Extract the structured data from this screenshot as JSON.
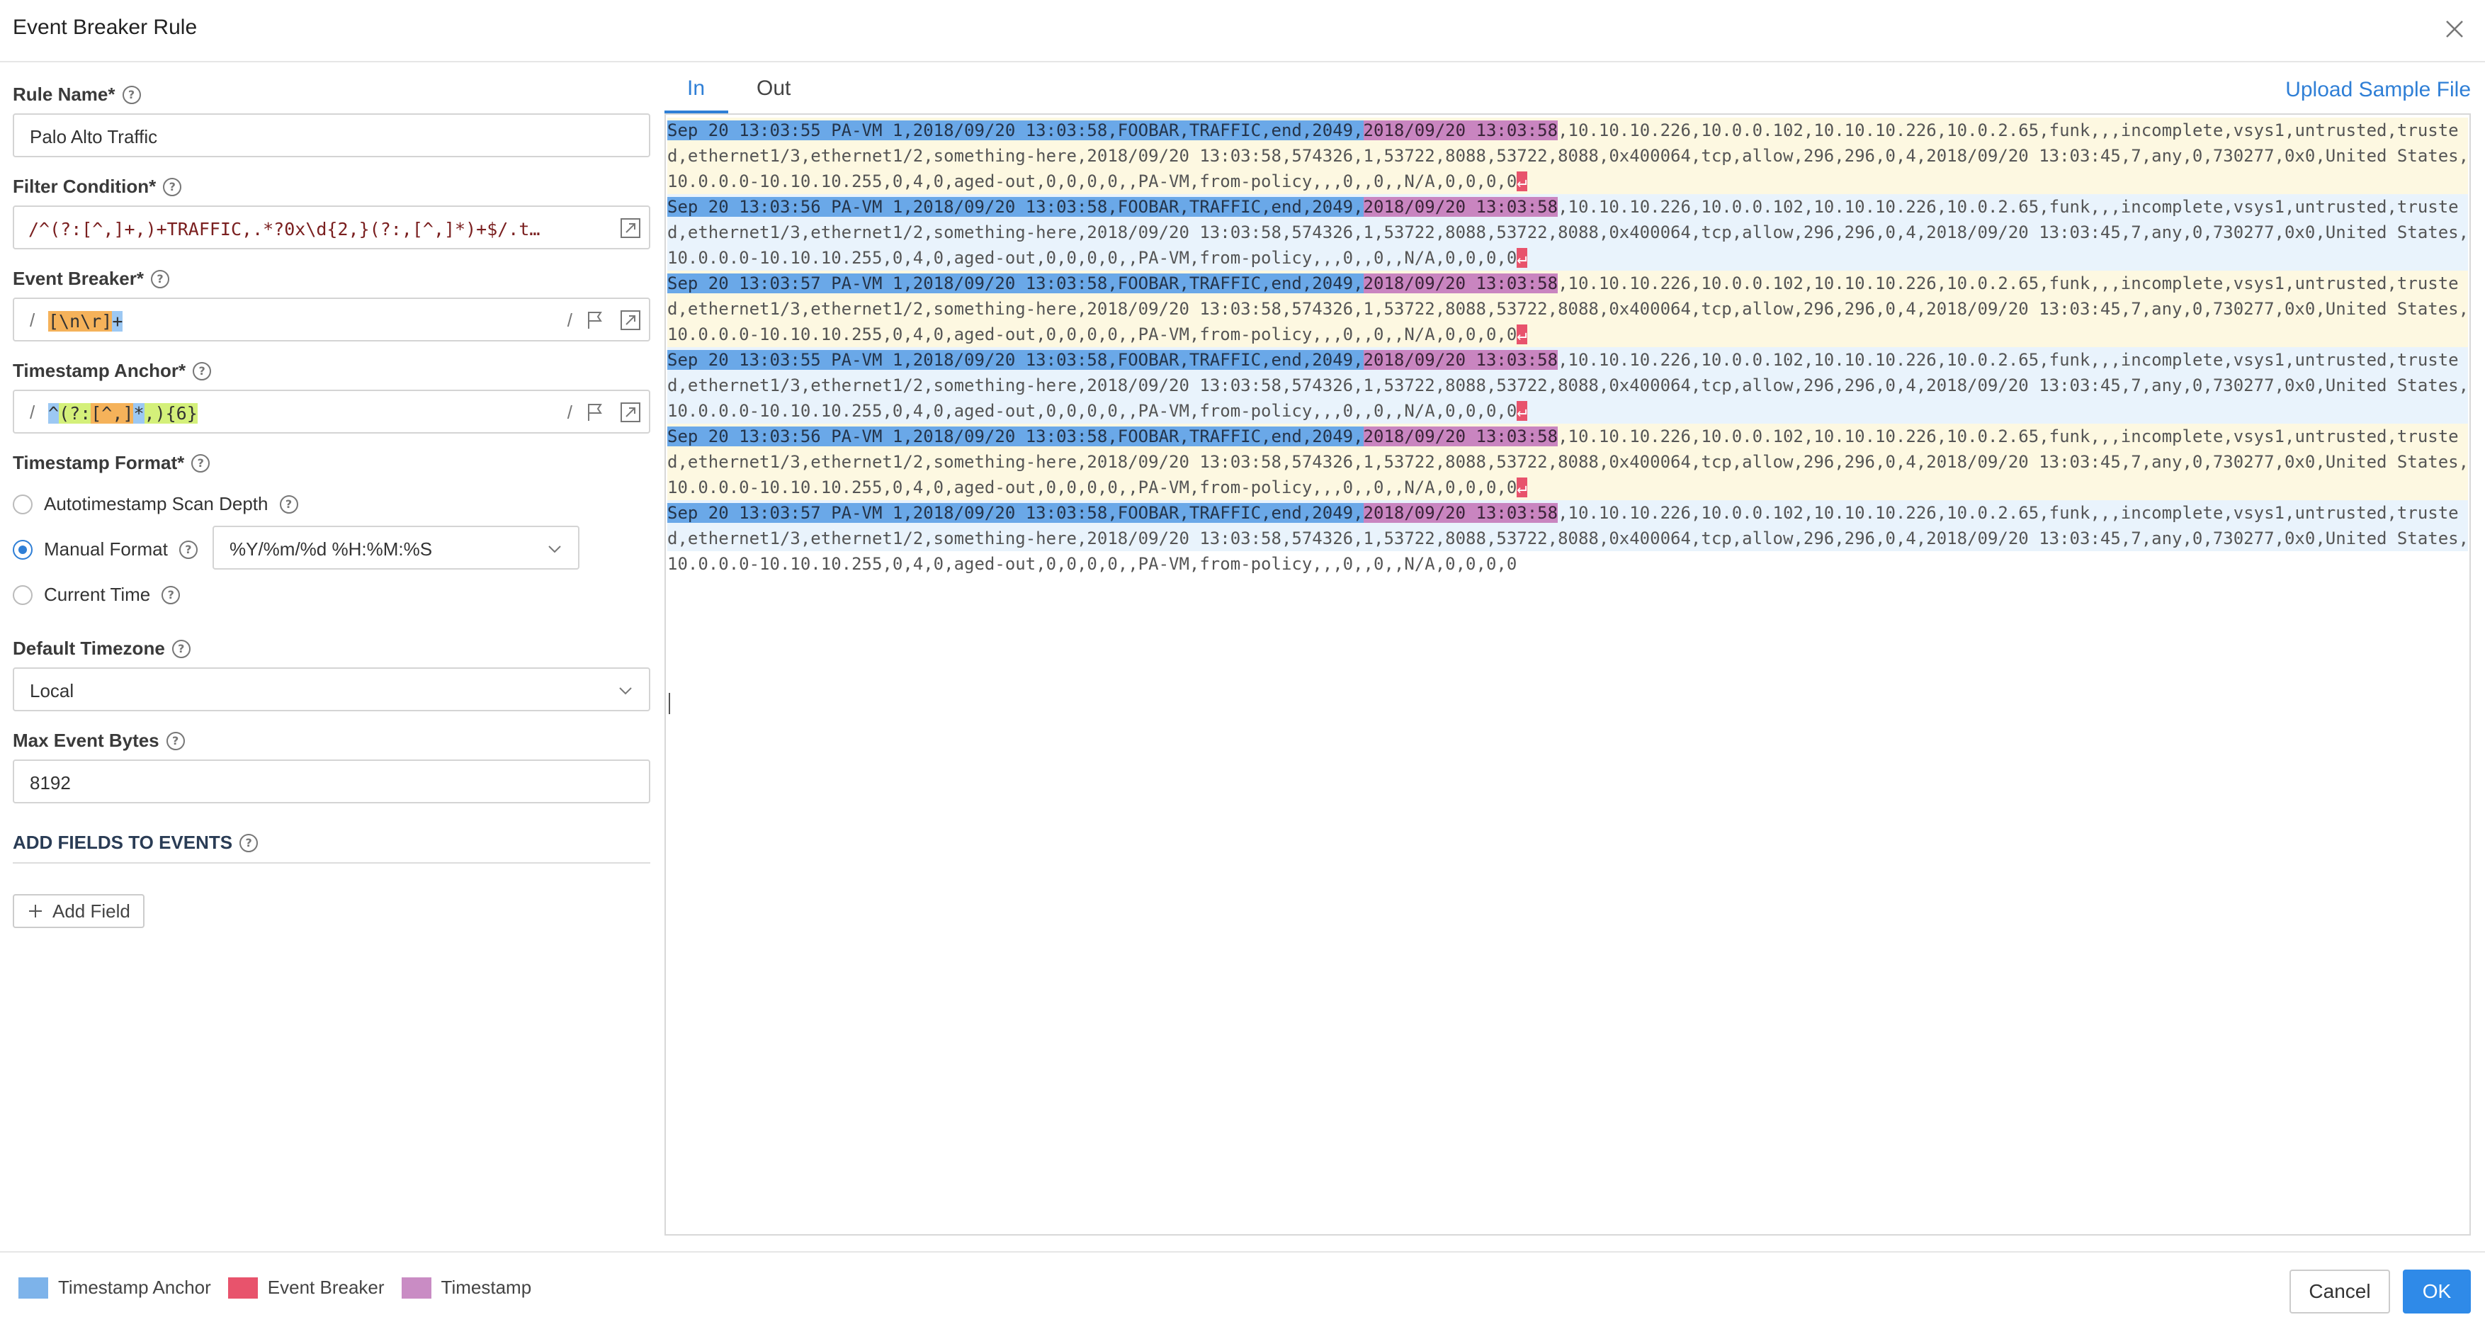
{
  "dialog": {
    "title": "Event Breaker Rule"
  },
  "form": {
    "rule_name_label": "Rule Name*",
    "rule_name_value": "Palo Alto Traffic",
    "filter_label": "Filter Condition*",
    "filter_value": "/^(?:[^,]+,)+TRAFFIC,.*?0x\\d{2,}(?:,[^,]*)+$/.t…",
    "breaker_label": "Event Breaker*",
    "breaker_slash": "/",
    "breaker_parts": [
      "[\\n\\r]",
      "+"
    ],
    "anchor_label": "Timestamp Anchor*",
    "anchor_slash": "/",
    "anchor_parts": [
      "^",
      "(?:",
      "[^,]",
      "*",
      ",",
      "){6}"
    ],
    "format_label": "Timestamp Format*",
    "format_options": {
      "auto": "Autotimestamp Scan Depth",
      "manual": "Manual Format",
      "current": "Current Time"
    },
    "format_selected": "Manual Format",
    "manual_format_value": "%Y/%m/%d %H:%M:%S",
    "timezone_label": "Default Timezone",
    "timezone_value": "Local",
    "max_bytes_label": "Max Event Bytes",
    "max_bytes_value": "8192",
    "add_fields_label": "ADD FIELDS TO EVENTS",
    "add_field_button": "Add Field"
  },
  "tabs": [
    {
      "label": "In",
      "active": true
    },
    {
      "label": "Out",
      "active": false
    }
  ],
  "upload_label": "Upload Sample File",
  "events": [
    {
      "anchor": "Sep 20 13:03:55 PA-VM 1,2018/09/20 13:03:58,FOOBAR,TRAFFIC,end,2049,",
      "ts": "2018/09/20 13:03:58",
      "rest1": ",10.10.10.226,10.0.0.102,10.10.10.226,10.0.2.65,funk,,,incomplete,vsys1,untrusted,truste",
      "line2": "d,ethernet1/3,ethernet1/2,something-here,2018/09/20 13:03:58,574326,1,53722,8088,53722,8088,0x400064,tcp,allow,296,296,0,4,2018/09/20 13:03:45,7,any,0,730277,0x0,United States,",
      "line3": "10.0.0.0-10.10.10.255,0,4,0,aged-out,0,0,0,0,,PA-VM,from-policy,,,0,,0,,N/A,0,0,0,0",
      "brk": "↵"
    },
    {
      "anchor": "Sep 20 13:03:56 PA-VM 1,2018/09/20 13:03:58,FOOBAR,TRAFFIC,end,2049,",
      "ts": "2018/09/20 13:03:58",
      "rest1": ",10.10.10.226,10.0.0.102,10.10.10.226,10.0.2.65,funk,,,incomplete,vsys1,untrusted,truste",
      "line2": "d,ethernet1/3,ethernet1/2,something-here,2018/09/20 13:03:58,574326,1,53722,8088,53722,8088,0x400064,tcp,allow,296,296,0,4,2018/09/20 13:03:45,7,any,0,730277,0x0,United States,",
      "line3": "10.0.0.0-10.10.10.255,0,4,0,aged-out,0,0,0,0,,PA-VM,from-policy,,,0,,0,,N/A,0,0,0,0",
      "brk": "↵"
    },
    {
      "anchor": "Sep 20 13:03:57 PA-VM 1,2018/09/20 13:03:58,FOOBAR,TRAFFIC,end,2049,",
      "ts": "2018/09/20 13:03:58",
      "rest1": ",10.10.10.226,10.0.0.102,10.10.10.226,10.0.2.65,funk,,,incomplete,vsys1,untrusted,truste",
      "line2": "d,ethernet1/3,ethernet1/2,something-here,2018/09/20 13:03:58,574326,1,53722,8088,53722,8088,0x400064,tcp,allow,296,296,0,4,2018/09/20 13:03:45,7,any,0,730277,0x0,United States,",
      "line3": "10.0.0.0-10.10.10.255,0,4,0,aged-out,0,0,0,0,,PA-VM,from-policy,,,0,,0,,N/A,0,0,0,0",
      "brk": "↵"
    },
    {
      "anchor": "Sep 20 13:03:55 PA-VM 1,2018/09/20 13:03:58,FOOBAR,TRAFFIC,end,2049,",
      "ts": "2018/09/20 13:03:58",
      "rest1": ",10.10.10.226,10.0.0.102,10.10.10.226,10.0.2.65,funk,,,incomplete,vsys1,untrusted,truste",
      "line2": "d,ethernet1/3,ethernet1/2,something-here,2018/09/20 13:03:58,574326,1,53722,8088,53722,8088,0x400064,tcp,allow,296,296,0,4,2018/09/20 13:03:45,7,any,0,730277,0x0,United States,",
      "line3": "10.0.0.0-10.10.10.255,0,4,0,aged-out,0,0,0,0,,PA-VM,from-policy,,,0,,0,,N/A,0,0,0,0",
      "brk": "↵"
    },
    {
      "anchor": "Sep 20 13:03:56 PA-VM 1,2018/09/20 13:03:58,FOOBAR,TRAFFIC,end,2049,",
      "ts": "2018/09/20 13:03:58",
      "rest1": ",10.10.10.226,10.0.0.102,10.10.10.226,10.0.2.65,funk,,,incomplete,vsys1,untrusted,truste",
      "line2": "d,ethernet1/3,ethernet1/2,something-here,2018/09/20 13:03:58,574326,1,53722,8088,53722,8088,0x400064,tcp,allow,296,296,0,4,2018/09/20 13:03:45,7,any,0,730277,0x0,United States,",
      "line3": "10.0.0.0-10.10.10.255,0,4,0,aged-out,0,0,0,0,,PA-VM,from-policy,,,0,,0,,N/A,0,0,0,0",
      "brk": "↵"
    },
    {
      "anchor": "Sep 20 13:03:57 PA-VM 1,2018/09/20 13:03:58,FOOBAR,TRAFFIC,end,2049,",
      "ts": "2018/09/20 13:03:58",
      "rest1": ",10.10.10.226,10.0.0.102,10.10.10.226,10.0.2.65,funk,,,incomplete,vsys1,untrusted,truste",
      "line2": "d,ethernet1/3,ethernet1/2,something-here,2018/09/20 13:03:58,574326,1,53722,8088,53722,8088,0x400064,tcp,allow,296,296,0,4,2018/09/20 13:03:45,7,any,0,730277,0x0,United States,",
      "line3": "10.0.0.0-10.10.10.255,0,4,0,aged-out,0,0,0,0,,PA-VM,from-policy,,,0,,0,,N/A,0,0,0,0",
      "brk": ""
    }
  ],
  "legend": [
    {
      "label": "Timestamp Anchor",
      "color": "#7db3ea"
    },
    {
      "label": "Event Breaker",
      "color": "#e8536c"
    },
    {
      "label": "Timestamp",
      "color": "#c98cc4"
    }
  ],
  "footer": {
    "cancel": "Cancel",
    "ok": "OK"
  }
}
